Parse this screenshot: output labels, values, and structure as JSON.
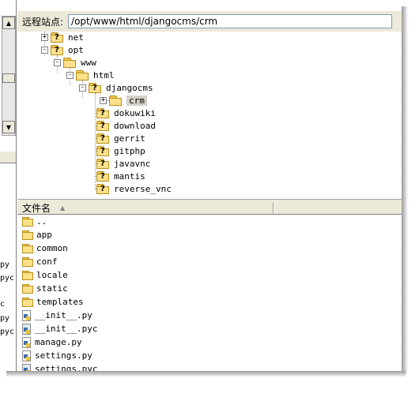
{
  "address": {
    "label": "远程站点:",
    "path": "/opt/www/html/djangocms/crm"
  },
  "tree": [
    {
      "label": "net",
      "icon": "folder-unknown-icon",
      "expander": "+"
    },
    {
      "label": "opt",
      "icon": "folder-unknown-icon",
      "expander": "-"
    },
    {
      "label": "www",
      "icon": "folder-icon",
      "expander": "-"
    },
    {
      "label": "html",
      "icon": "folder-icon",
      "expander": "-"
    },
    {
      "label": "djangocms",
      "icon": "folder-unknown-icon",
      "expander": "-"
    },
    {
      "label": "crm",
      "icon": "folder-icon",
      "expander": "+",
      "selected": true
    },
    {
      "label": "dokuwiki",
      "icon": "folder-unknown-icon"
    },
    {
      "label": "download",
      "icon": "folder-unknown-icon"
    },
    {
      "label": "gerrit",
      "icon": "folder-unknown-icon"
    },
    {
      "label": "gitphp",
      "icon": "folder-unknown-icon"
    },
    {
      "label": "javavnc",
      "icon": "folder-unknown-icon"
    },
    {
      "label": "mantis",
      "icon": "folder-unknown-icon"
    },
    {
      "label": "reverse_vnc",
      "icon": "folder-unknown-icon"
    }
  ],
  "list_header": {
    "filename": "文件名",
    "sort_icon": "sort-ascending-icon"
  },
  "files": [
    {
      "name": "..",
      "icon": "folder-icon"
    },
    {
      "name": "app",
      "icon": "folder-icon"
    },
    {
      "name": "common",
      "icon": "folder-icon"
    },
    {
      "name": "conf",
      "icon": "folder-icon"
    },
    {
      "name": "locale",
      "icon": "folder-icon"
    },
    {
      "name": "static",
      "icon": "folder-icon"
    },
    {
      "name": "templates",
      "icon": "folder-icon"
    },
    {
      "name": "__init__.py",
      "icon": "python-file-icon"
    },
    {
      "name": "__init__.pyc",
      "icon": "python-compiled-icon"
    },
    {
      "name": "manage.py",
      "icon": "python-file-icon"
    },
    {
      "name": "settings.py",
      "icon": "python-file-icon"
    },
    {
      "name": "settings.pyc",
      "icon": "python-compiled-icon"
    }
  ],
  "left_fragments": [
    "py",
    "pyc",
    "c",
    "py",
    "pyc"
  ],
  "scroll": {
    "up": "▲",
    "down": "▼"
  }
}
